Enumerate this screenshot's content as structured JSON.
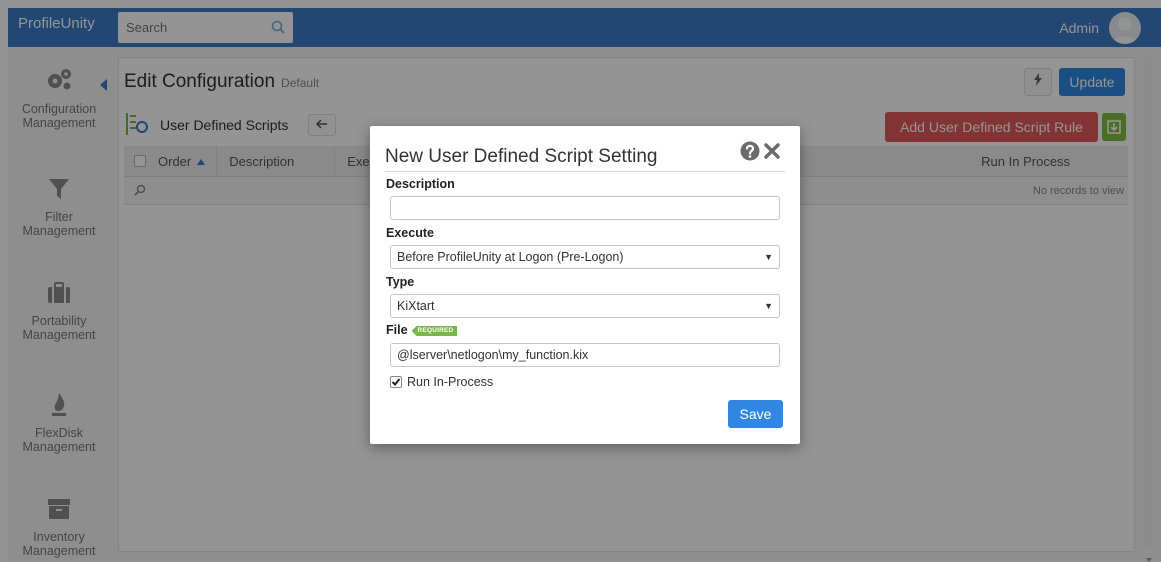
{
  "app": {
    "logo": "ProfileUnity",
    "user": "Admin"
  },
  "search": {
    "placeholder": "Search"
  },
  "sidebar": {
    "items": [
      {
        "label": "Configuration Management",
        "icon": "gears-icon"
      },
      {
        "label": "Filter Management",
        "icon": "filter-icon"
      },
      {
        "label": "Portability Management",
        "icon": "briefcase-icon"
      },
      {
        "label": "FlexDisk Management",
        "icon": "flame-icon"
      },
      {
        "label": "Inventory Management",
        "icon": "archive-icon"
      }
    ]
  },
  "page": {
    "title": "Edit Configuration",
    "subtitle": "Default",
    "update_label": "Update",
    "section": "User Defined Scripts",
    "add_label": "Add User Defined Script Rule",
    "columns": [
      "Order",
      "Description",
      "Exec",
      "Run In Process"
    ],
    "empty_text": "No records to view"
  },
  "modal": {
    "title": "New User Defined Script Setting",
    "description_label": "Description",
    "description_value": "",
    "execute_label": "Execute",
    "execute_value": "Before ProfileUnity at Logon (Pre-Logon)",
    "type_label": "Type",
    "type_value": "KiXtart",
    "file_label": "File",
    "required_badge": "REQUIRED",
    "file_value": "@lserver\\netlogon\\my_function.kix",
    "run_in_process_label": "Run In-Process",
    "run_in_process_checked": true,
    "save_label": "Save"
  },
  "colors": {
    "topbar": "#3a7bc5",
    "primary_button": "#2f87e2",
    "danger_button": "#e05a5a",
    "required_badge": "#7ab648"
  }
}
